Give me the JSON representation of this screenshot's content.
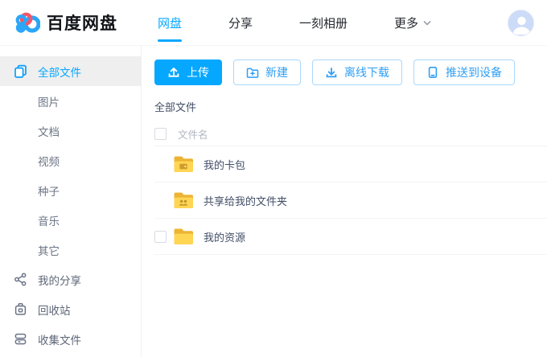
{
  "colors": {
    "brand_blue": "#06a7ff",
    "folder_yellow": "#ffd554",
    "folder_back": "#edb434"
  },
  "header": {
    "logo_text": "百度网盘",
    "nav": [
      {
        "label": "网盘",
        "active": true
      },
      {
        "label": "分享",
        "active": false
      },
      {
        "label": "一刻相册",
        "active": false
      },
      {
        "label": "更多",
        "active": false,
        "has_dropdown": true
      }
    ]
  },
  "sidebar": {
    "items": [
      {
        "label": "全部文件",
        "icon": "files-icon",
        "active": true
      },
      {
        "label": "图片"
      },
      {
        "label": "文档"
      },
      {
        "label": "视频"
      },
      {
        "label": "种子"
      },
      {
        "label": "音乐"
      },
      {
        "label": "其它"
      },
      {
        "label": "我的分享",
        "icon": "share-icon"
      },
      {
        "label": "回收站",
        "icon": "trash-icon"
      },
      {
        "label": "收集文件",
        "icon": "collect-icon"
      }
    ]
  },
  "toolbar": {
    "upload_label": "上传",
    "new_label": "新建",
    "offline_download_label": "离线下载",
    "push_to_device_label": "推送到设备"
  },
  "breadcrumb": "全部文件",
  "file_list": {
    "name_column": "文件名",
    "rows": [
      {
        "name": "我的卡包",
        "icon": "folder-card-icon"
      },
      {
        "name": "共享给我的文件夹",
        "icon": "folder-shared-icon"
      },
      {
        "name": "我的资源",
        "icon": "folder-icon",
        "checkbox_visible": true
      }
    ]
  }
}
